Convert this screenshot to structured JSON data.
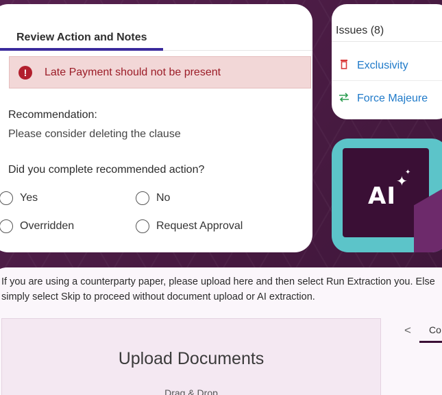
{
  "review": {
    "tab_label": "Review Action and Notes",
    "alert": {
      "icon": "!",
      "text": "Late Payment should not be present"
    },
    "recommendation_label": "Recommendation:",
    "recommendation_text": "Please consider deleting the clause",
    "question": "Did you complete recommended action?",
    "options": [
      "Yes",
      "No",
      "Overridden",
      "Request Approval"
    ]
  },
  "issues": {
    "header": "Issues (8)",
    "items": [
      {
        "label": "Exclusivity",
        "icon": "trash-icon",
        "color": "#d93a3a"
      },
      {
        "label": "Force Majeure",
        "icon": "swap-icon",
        "color": "#2e9e52"
      }
    ]
  },
  "ai_badge": {
    "text": "AI",
    "accent": "#5cc4c9"
  },
  "upload": {
    "info": "If you are using a counterparty paper, please upload here and then select Run Extraction you. Else simply select Skip to proceed without document upload or AI extraction.",
    "title": "Upload Documents",
    "subtitle": "Drag & Drop",
    "side_tab": "Co",
    "nav_prev": "<"
  },
  "colors": {
    "background": "#4a1d4a",
    "tab_underline": "#3a2a9c",
    "alert_bg": "#f2d7d7",
    "alert_text": "#9b1c27",
    "link": "#1f7ac9"
  }
}
